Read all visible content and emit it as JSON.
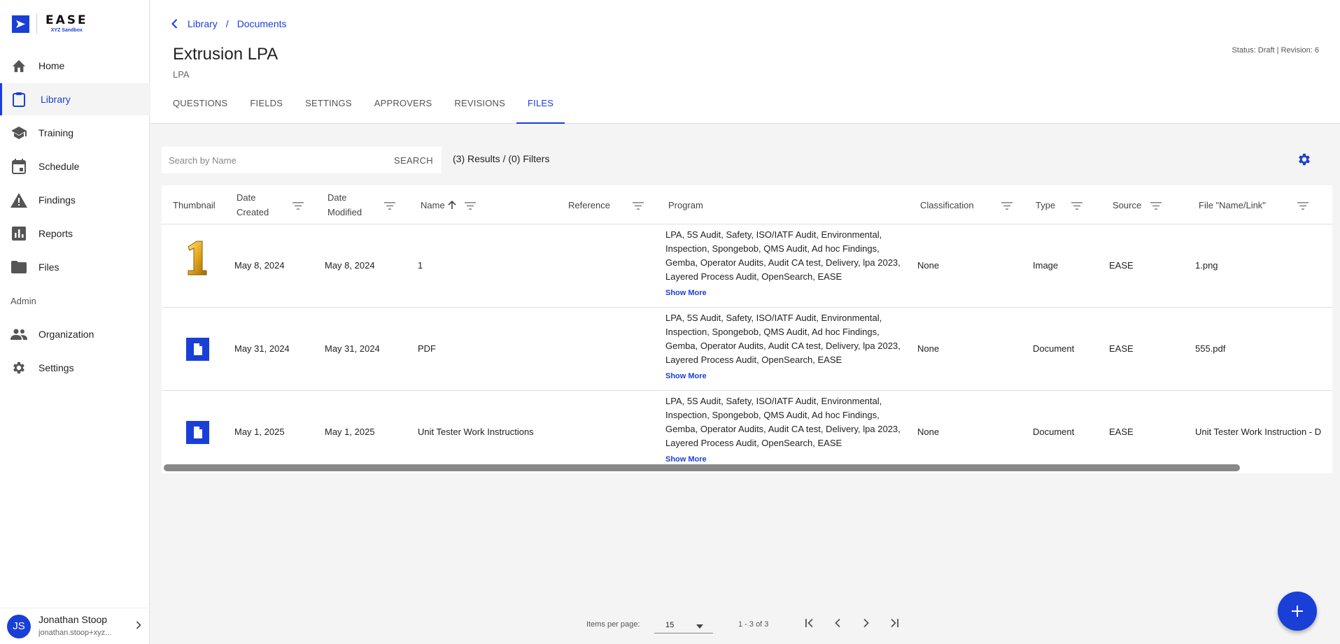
{
  "app": {
    "logo_name": "EASE",
    "logo_sub": "XYZ Sandbox"
  },
  "sidebar": {
    "items": [
      {
        "label": "Home",
        "icon": "home-icon"
      },
      {
        "label": "Library",
        "icon": "clipboard-icon",
        "active": true
      },
      {
        "label": "Training",
        "icon": "graduation-cap-icon"
      },
      {
        "label": "Schedule",
        "icon": "calendar-icon"
      },
      {
        "label": "Findings",
        "icon": "warning-icon"
      },
      {
        "label": "Reports",
        "icon": "bar-chart-icon"
      },
      {
        "label": "Files",
        "icon": "folder-icon"
      }
    ],
    "section_admin": "Admin",
    "admin_items": [
      {
        "label": "Organization",
        "icon": "people-icon"
      },
      {
        "label": "Settings",
        "icon": "gear-icon"
      }
    ]
  },
  "user": {
    "initials": "JS",
    "name": "Jonathan Stoop",
    "email": "jonathan.stoop+xyz..."
  },
  "breadcrumb": {
    "items": [
      "Library",
      "Documents"
    ],
    "separator": "/"
  },
  "page": {
    "title": "Extrusion LPA",
    "subtitle": "LPA",
    "status": "Status: Draft | Revision: 6"
  },
  "tabs": [
    "QUESTIONS",
    "FIELDS",
    "SETTINGS",
    "APPROVERS",
    "REVISIONS",
    "FILES"
  ],
  "active_tab": "FILES",
  "search": {
    "placeholder": "Search by Name",
    "button": "SEARCH",
    "results": "(3) Results / (0) Filters"
  },
  "table": {
    "columns": {
      "thumbnail": "Thumbnail",
      "date_created_1": "Date",
      "date_created_2": "Created",
      "date_modified_1": "Date",
      "date_modified_2": "Modified",
      "name": "Name",
      "reference": "Reference",
      "program": "Program",
      "classification": "Classification",
      "type": "Type",
      "source": "Source",
      "file": "File \"Name/Link\""
    },
    "rows": [
      {
        "thumb": "number-one-image",
        "created": "May 8, 2024",
        "modified": "May 8, 2024",
        "name": "1",
        "reference": "",
        "program": "LPA, 5S Audit, Safety, ISO/IATF Audit, Environmental, Inspection, Spongebob, QMS Audit, Ad hoc Findings, Gemba, Operator Audits, Audit CA test, Delivery, lpa 2023, Layered Process Audit, OpenSearch, EASE",
        "show_more": "Show More",
        "classification": "None",
        "type": "Image",
        "source": "EASE",
        "file": "1.png"
      },
      {
        "thumb": "document-icon",
        "created": "May 31, 2024",
        "modified": "May 31, 2024",
        "name": "PDF",
        "reference": "",
        "program": "LPA, 5S Audit, Safety, ISO/IATF Audit, Environmental, Inspection, Spongebob, QMS Audit, Ad hoc Findings, Gemba, Operator Audits, Audit CA test, Delivery, lpa 2023, Layered Process Audit, OpenSearch, EASE",
        "show_more": "Show More",
        "classification": "None",
        "type": "Document",
        "source": "EASE",
        "file": "555.pdf"
      },
      {
        "thumb": "document-icon",
        "created": "May 1, 2025",
        "modified": "May 1, 2025",
        "name": "Unit Tester Work Instructions",
        "reference": "",
        "program": "LPA, 5S Audit, Safety, ISO/IATF Audit, Environmental, Inspection, Spongebob, QMS Audit, Ad hoc Findings, Gemba, Operator Audits, Audit CA test, Delivery, lpa 2023, Layered Process Audit, OpenSearch, EASE",
        "show_more": "Show More",
        "classification": "None",
        "type": "Document",
        "source": "EASE",
        "file": "Unit Tester Work Instruction - D"
      }
    ]
  },
  "pagination": {
    "items_per_page_label": "Items per page:",
    "items_per_page": "15",
    "range": "1 - 3 of 3"
  },
  "colors": {
    "accent": "#1a3fd6"
  }
}
